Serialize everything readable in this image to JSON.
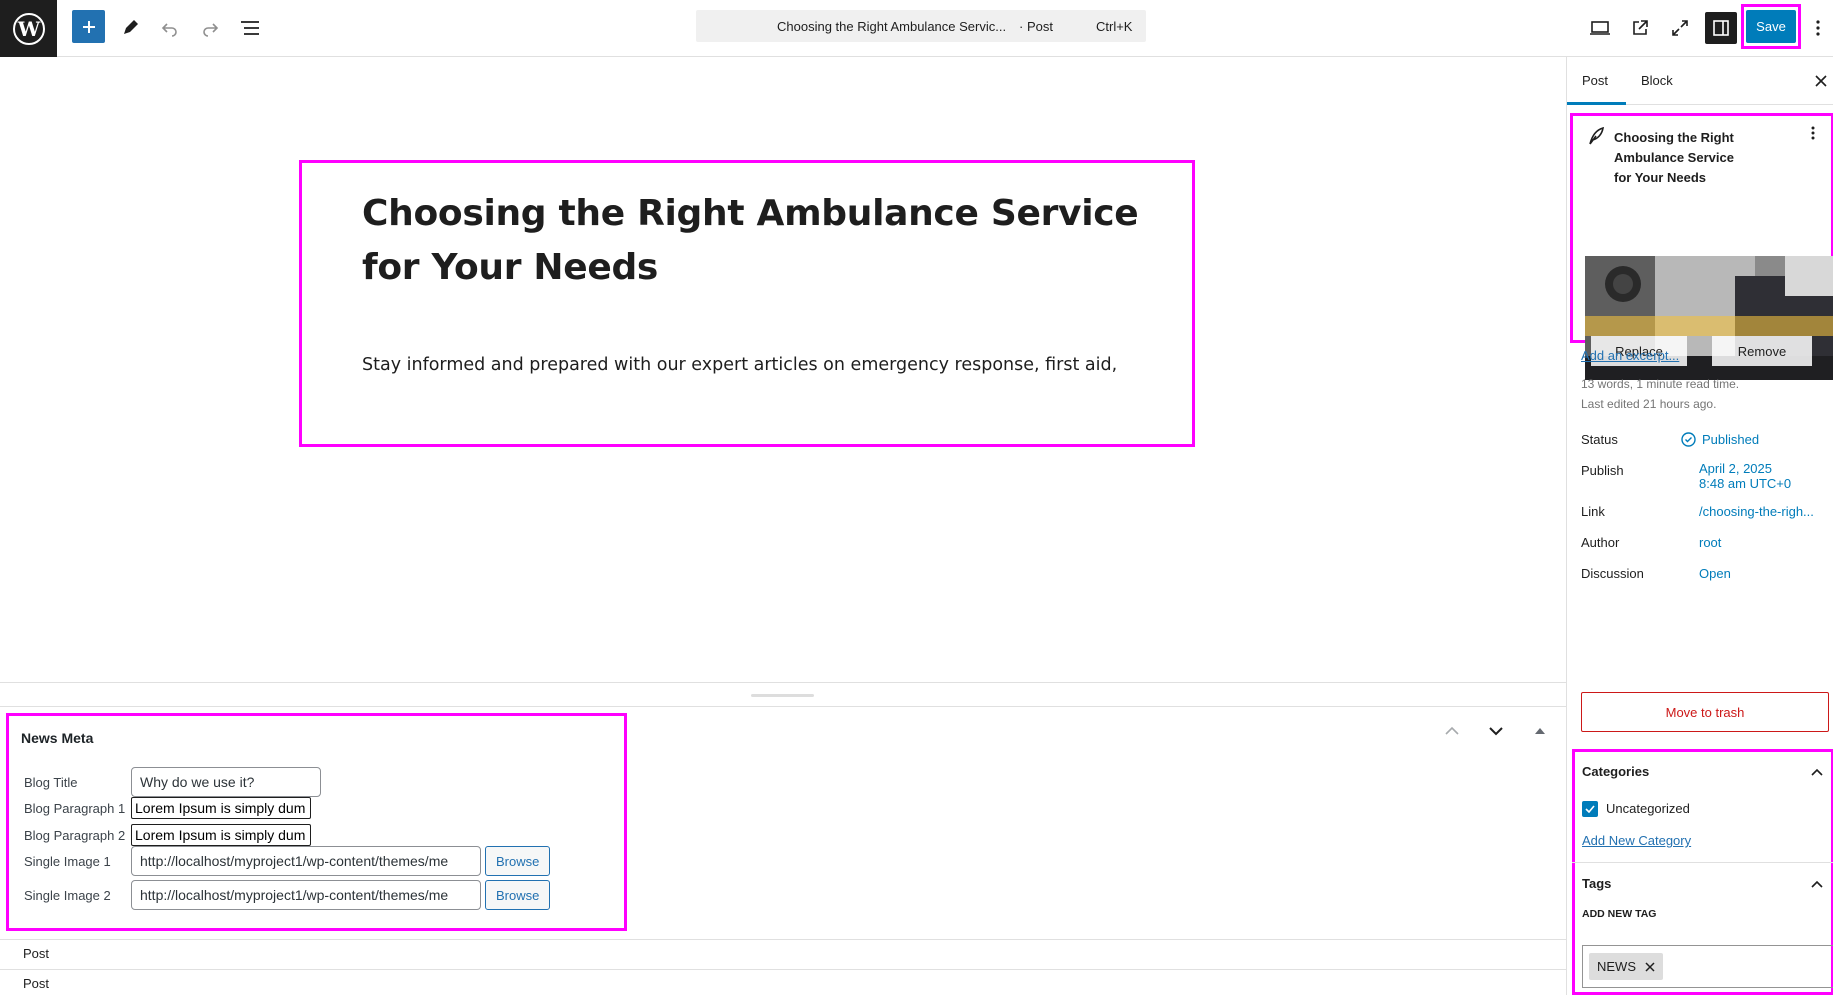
{
  "toolbar": {
    "command_title": "Choosing the Right Ambulance Servic...",
    "command_type": "· Post",
    "command_shortcut": "Ctrl+K",
    "save_label": "Save",
    "accent_color": "#007cba"
  },
  "post": {
    "title": "Choosing the Right Ambulance Service for Your Needs",
    "paragraph": "Stay informed and prepared with our expert articles on emergency response, first aid,"
  },
  "news_meta": {
    "heading": "News Meta",
    "fields": [
      {
        "label": "Blog Title",
        "value": "Why do we use it?"
      },
      {
        "label": "Blog Paragraph 1",
        "value": "Lorem Ipsum is simply dum"
      },
      {
        "label": "Blog Paragraph 2",
        "value": "Lorem Ipsum is simply dum"
      },
      {
        "label": "Single Image 1",
        "value": "http://localhost/myproject1/wp-content/themes/me",
        "button": "Browse"
      },
      {
        "label": "Single Image 2",
        "value": "http://localhost/myproject1/wp-content/themes/me",
        "button": "Browse"
      }
    ]
  },
  "bottom_rows": [
    "Post",
    "Post"
  ],
  "sidebar": {
    "tabs": [
      "Post",
      "Block"
    ],
    "card_title": "Choosing the Right Ambulance Service for Your Needs",
    "image_buttons": {
      "replace": "Replace",
      "remove": "Remove"
    },
    "add_excerpt": "Add an excerpt...",
    "stats": "13 words, 1 minute read time.",
    "last_edited": "Last edited 21 hours ago.",
    "rows": {
      "status": {
        "label": "Status",
        "value": "Published"
      },
      "publish": {
        "label": "Publish",
        "value_line1": "April 2, 2025",
        "value_line2": "8:48 am UTC+0"
      },
      "link": {
        "label": "Link",
        "value": "/choosing-the-righ..."
      },
      "author": {
        "label": "Author",
        "value": "root"
      },
      "discussion": {
        "label": "Discussion",
        "value": "Open"
      }
    },
    "trash": "Move to trash",
    "categories": {
      "heading": "Categories",
      "items": [
        {
          "label": "Uncategorized",
          "checked": true
        }
      ],
      "add_new": "Add New Category"
    },
    "tags": {
      "heading": "Tags",
      "add_label": "ADD NEW TAG",
      "items": [
        "NEWS"
      ]
    }
  }
}
